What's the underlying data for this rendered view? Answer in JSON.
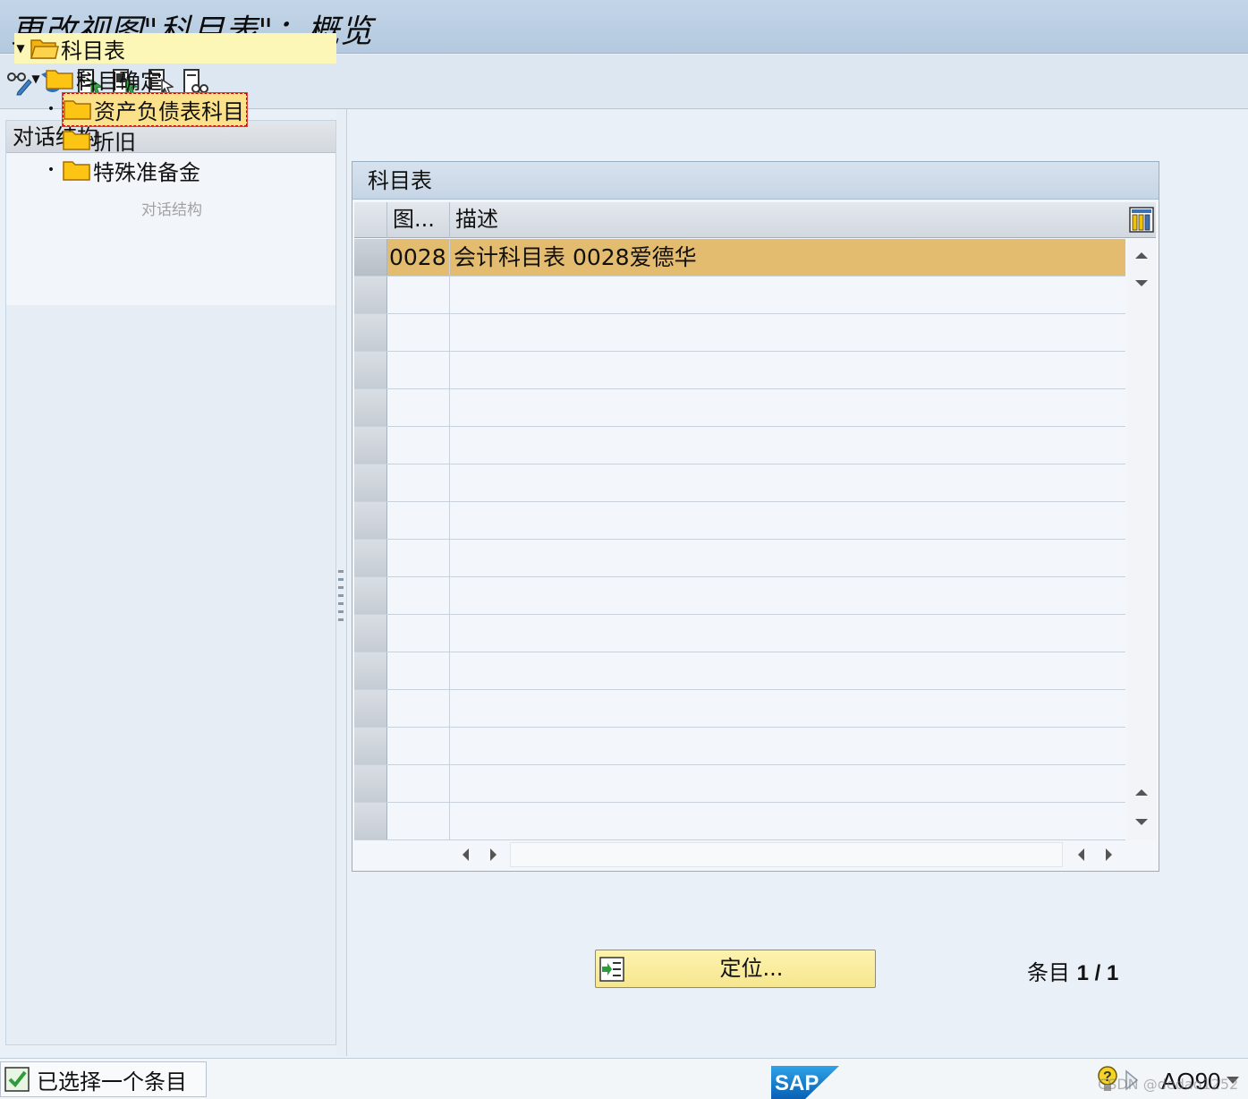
{
  "window": {
    "title": "更改视图\"科目表\"：概览"
  },
  "toolbar": {
    "buttons": [
      {
        "name": "display-change",
        "icon": "glasses-pencil-icon"
      },
      {
        "name": "undo",
        "icon": "undo-icon"
      },
      {
        "name": "select-all",
        "icon": "select-all-icon"
      },
      {
        "name": "select-block",
        "icon": "select-block-icon"
      },
      {
        "name": "deselect-all",
        "icon": "deselect-all-icon"
      },
      {
        "name": "find",
        "icon": "find-icon"
      }
    ]
  },
  "dialog_structure": {
    "header": "对话结构",
    "nodes": [
      {
        "label": "科目表",
        "level": 0,
        "expanded": true,
        "selected": true
      },
      {
        "label": "科目确定",
        "level": 1,
        "expanded": true
      },
      {
        "label": "资产负债表科目",
        "level": 2,
        "focused": true
      },
      {
        "label": "折旧",
        "level": 2
      },
      {
        "label": "特殊准备金",
        "level": 2
      }
    ],
    "drag_ghost": "对话结构"
  },
  "table": {
    "title": "科目表",
    "columns": {
      "code": "图...",
      "description": "描述"
    },
    "rows": [
      {
        "code": "0028",
        "description": "会计科目表 0028爱德华",
        "selected": true
      }
    ],
    "empty_rows": 15
  },
  "position_button": {
    "label": "定位..."
  },
  "entry_count": {
    "label": "条目",
    "value": "1 / 1"
  },
  "status_bar": {
    "message": "已选择一个条目",
    "transaction": "AO90",
    "watermark": "CSDN @dedao1252"
  },
  "colors": {
    "title_bar": "#b4c9df",
    "selected_row": "#e3bc70",
    "selected_node": "#fcf6b7",
    "button": "#f6e68e"
  }
}
